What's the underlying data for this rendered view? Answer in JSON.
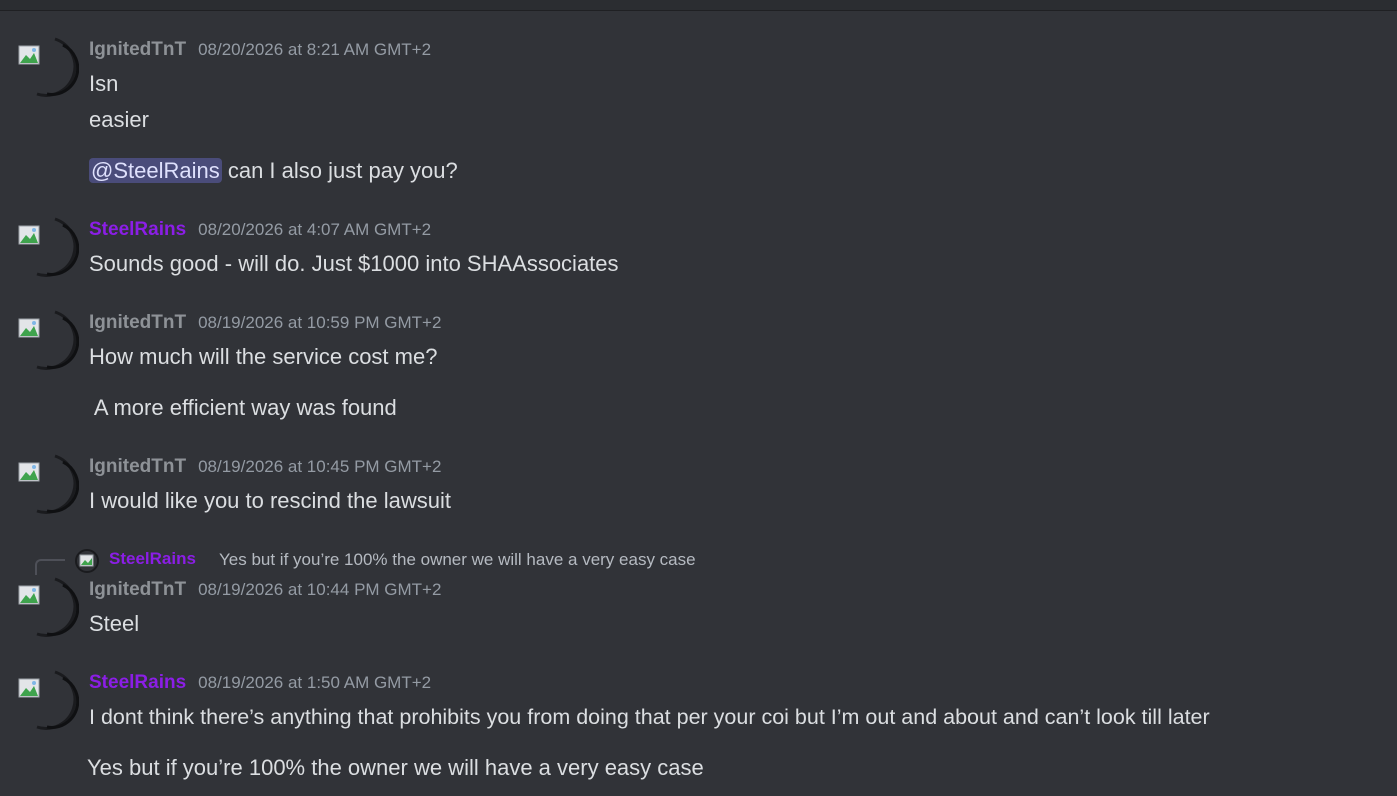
{
  "messages": [
    {
      "author": "IgnitedTnT",
      "timestamp": "08/20/2026 at 8:21 AM GMT+2",
      "lines": [
        "Isn",
        "easier"
      ],
      "mention": "@SteelRains",
      "mention_rest": " can I also just pay you?"
    },
    {
      "author": "SteelRains",
      "timestamp": "08/20/2026 at 4:07 AM GMT+2",
      "lines": [
        "Sounds good - will do. Just $1000 into SHAAssociates"
      ]
    },
    {
      "author": "IgnitedTnT",
      "timestamp": "08/19/2026 at 10:59 PM GMT+2",
      "lines": [
        "How much will the service cost me?",
        " A more efficient way was found"
      ]
    },
    {
      "author": "IgnitedTnT",
      "timestamp": "08/19/2026 at 10:45 PM GMT+2",
      "lines": [
        "I would like you to rescind the lawsuit"
      ]
    },
    {
      "reply_to": {
        "author": "SteelRains",
        "text": "Yes but if you’re 100% the owner we will have a very easy case"
      },
      "author": "IgnitedTnT",
      "timestamp": "08/19/2026 at 10:44 PM GMT+2",
      "lines": [
        "Steel"
      ]
    },
    {
      "author": "SteelRains",
      "timestamp": "08/19/2026 at 1:50 AM GMT+2",
      "lines": [
        "I dont think there’s anything that prohibits you from doing that per your coi but I’m out and about and can’t look till later",
        "Yes but if you’re 100% the owner we will have a very easy case"
      ]
    }
  ],
  "colors": {
    "background": "#313338",
    "author_default": "#8e9297",
    "author_steelrains": "#8b1ee6",
    "timestamp": "#949ba4",
    "message_text": "#dbdee1",
    "mention_bg": "#4a4c7a"
  },
  "icons": {
    "avatar": "broken-image-avatar-icon",
    "reply": "reply-connector-icon"
  }
}
